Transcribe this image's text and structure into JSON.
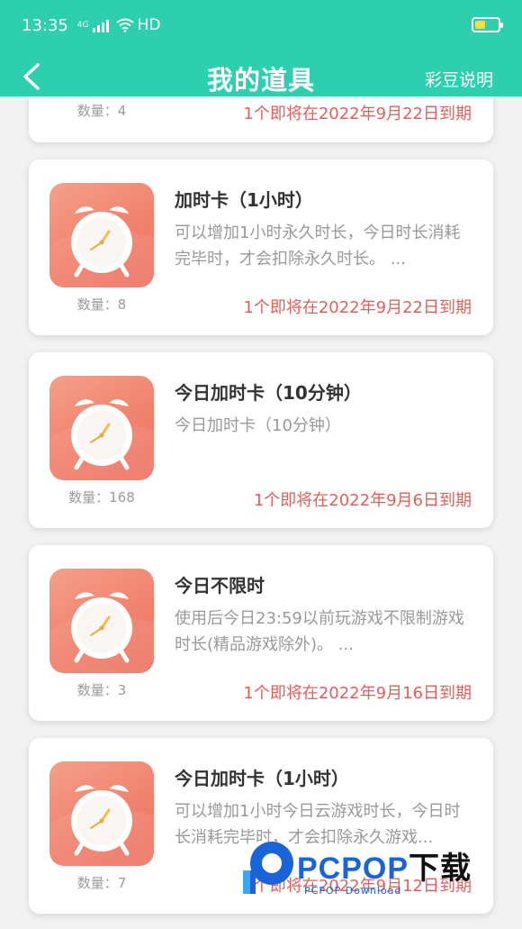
{
  "status_bar": {
    "time": "13:35",
    "network_type": "4G",
    "hd_label": "HD"
  },
  "nav": {
    "title": "我的道具",
    "action_label": "彩豆说明"
  },
  "colors": {
    "header_bg": "#2ecfae",
    "expiry_text": "#e0605a",
    "icon_gradient_start": "#f4a089",
    "icon_gradient_end": "#ee7566"
  },
  "items": [
    {
      "title": "",
      "description": "",
      "quantity_label": "数量：4",
      "expiry": "1个即将在2022年9月22日到期",
      "icon": "alarm-clock-icon"
    },
    {
      "title": "加时卡（1小时）",
      "description": "可以增加1小时永久时长，今日时长消耗完毕时，才会扣除永久时长。 ...",
      "quantity_label": "数量：8",
      "expiry": "1个即将在2022年9月22日到期",
      "icon": "alarm-clock-icon"
    },
    {
      "title": "今日加时卡（10分钟）",
      "description": "今日加时卡（10分钟）",
      "quantity_label": "数量：168",
      "expiry": "1个即将在2022年9月6日到期",
      "icon": "alarm-clock-icon"
    },
    {
      "title": "今日不限时",
      "description": "使用后今日23:59以前玩游戏不限制游戏时长(精品游戏除外)。 ...",
      "quantity_label": "数量：3",
      "expiry": "1个即将在2022年9月16日到期",
      "icon": "alarm-clock-icon"
    },
    {
      "title": "今日加时卡（1小时）",
      "description": "可以增加1小时今日云游戏时长，今日时长消耗完毕时，才会扣除永久游戏...",
      "quantity_label": "数量：7",
      "expiry": "1个即将在2022年9月12日到期",
      "icon": "alarm-clock-icon"
    }
  ],
  "watermark": {
    "brand": "PCPOP",
    "brand_cn": "下载",
    "sub": "PCPOP Download"
  }
}
